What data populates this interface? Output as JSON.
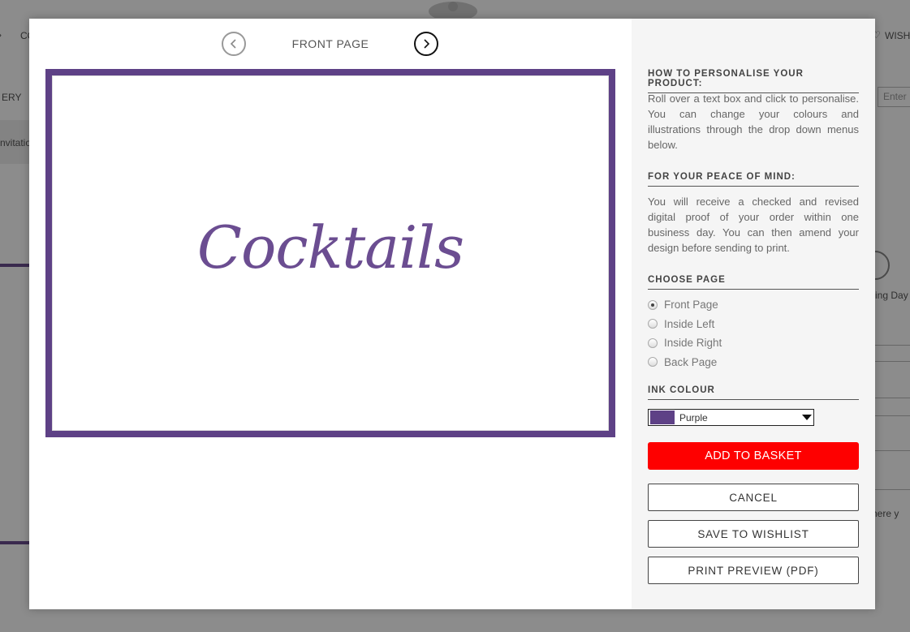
{
  "background": {
    "top_left_link": "CO",
    "top_right_link": "WISH",
    "nav_fragment": "ERY",
    "breadcrumb_fragment": "nvitatio",
    "search_placeholder": "Enter",
    "side_fragment": "ing Day",
    "footer_fragment": "here y"
  },
  "preview": {
    "page_label": "FRONT PAGE",
    "card_text": "Cocktails"
  },
  "panel": {
    "how_title": "HOW TO PERSONALISE YOUR PRODUCT:",
    "how_text": "Roll over a text box and click to personalise. You can change your colours and illustrations through the drop down menus below.",
    "peace_title": "FOR YOUR PEACE OF MIND:",
    "peace_text": "You will receive a checked and revised digital proof of your order within one business day. You can then amend your design before sending to print.",
    "choose_title": "CHOOSE PAGE",
    "pages": [
      "Front Page",
      "Inside Left",
      "Inside Right",
      "Back Page"
    ],
    "selected_page": "Front Page",
    "ink_title": "INK COLOUR",
    "ink_value": "Purple",
    "ink_color": "#5e4186",
    "add_to_basket": "ADD TO BASKET",
    "cancel": "CANCEL",
    "save_to_wishlist": "SAVE TO WISHLIST",
    "print_preview": "PRINT PREVIEW (PDF)"
  },
  "colors": {
    "accent_red": "#fe0000",
    "card_border": "#5e4186",
    "script_text": "#6b4d91"
  }
}
